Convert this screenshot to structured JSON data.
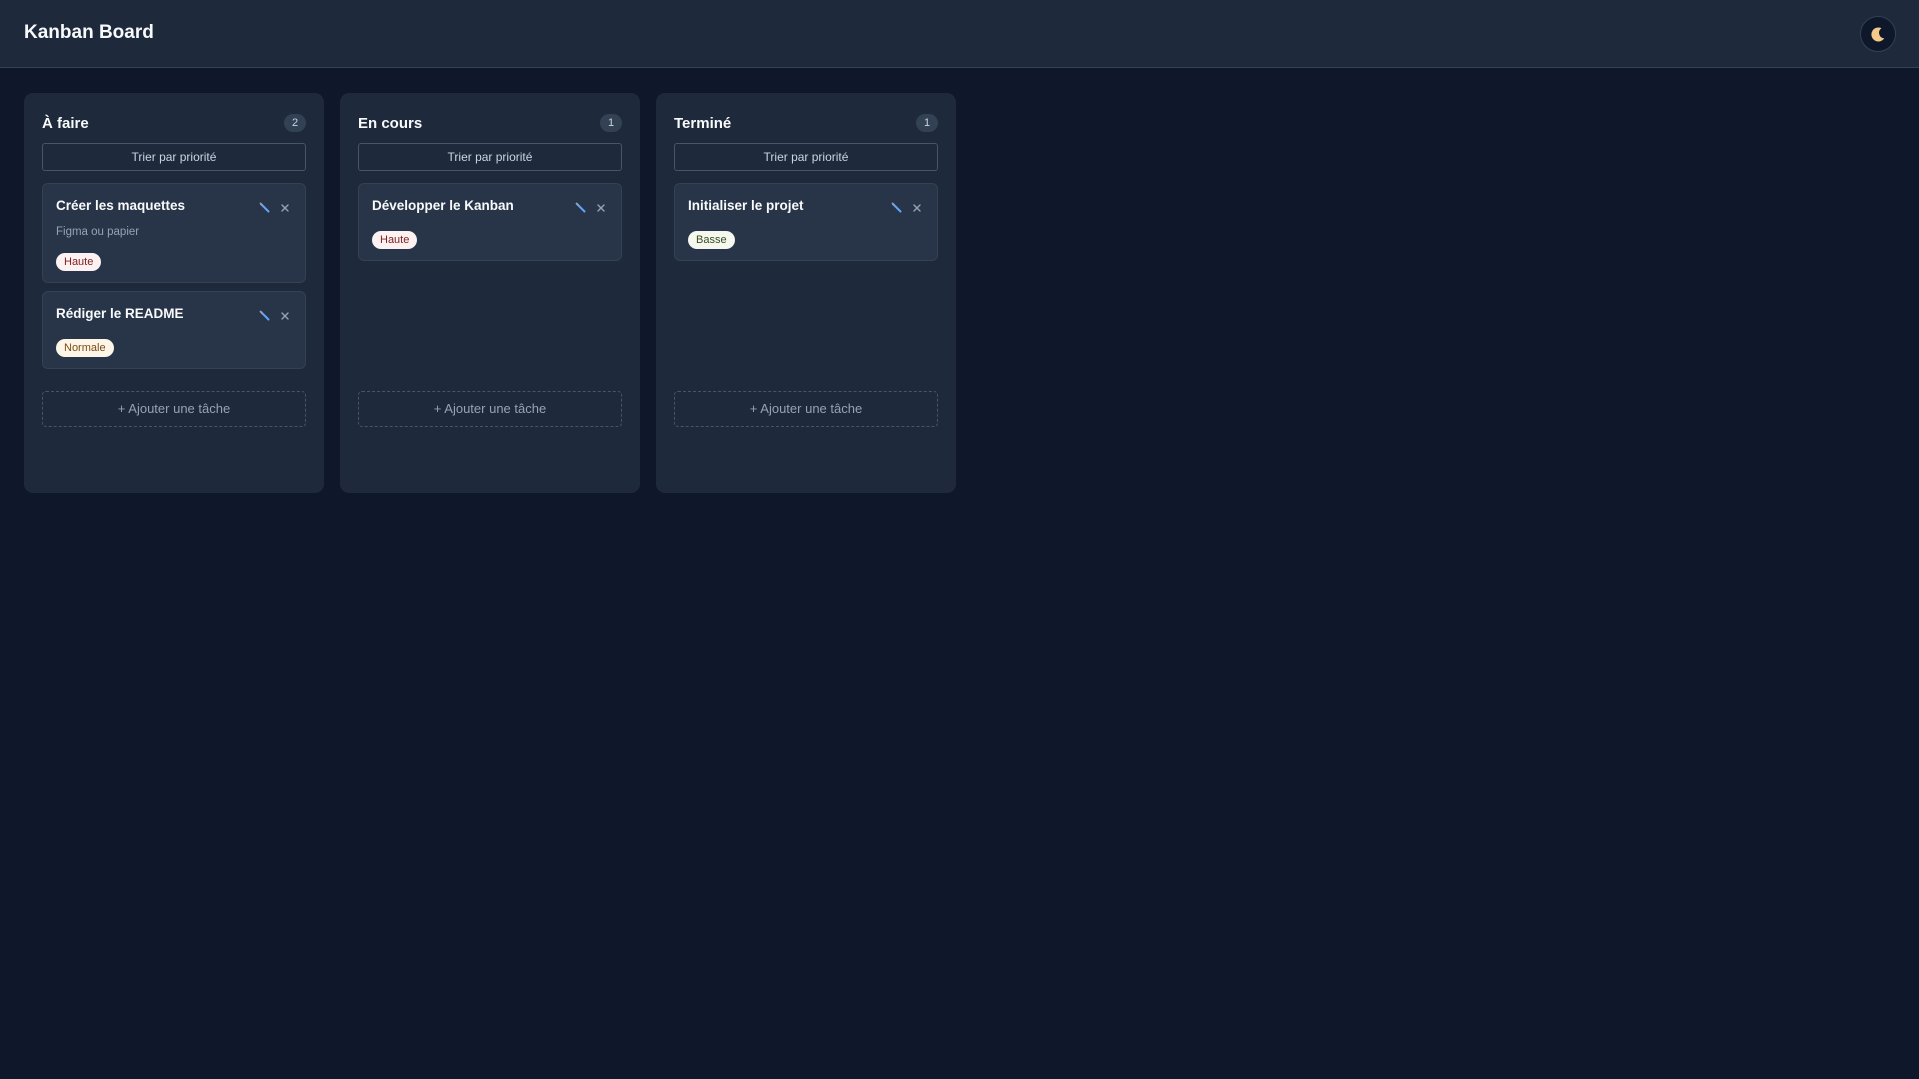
{
  "header": {
    "title": "Kanban Board",
    "theme_toggle_icon": "moon-icon"
  },
  "columns": [
    {
      "title": "À faire",
      "count": "2",
      "sort_label": "Trier par priorité",
      "add_label": "+ Ajouter une tâche",
      "cards": [
        {
          "title": "Créer les maquettes",
          "description": "Figma ou papier",
          "priority": "Haute"
        },
        {
          "title": "Rédiger le README",
          "description": "",
          "priority": "Normale"
        }
      ]
    },
    {
      "title": "En cours",
      "count": "1",
      "sort_label": "Trier par priorité",
      "add_label": "+ Ajouter une tâche",
      "cards": [
        {
          "title": "Développer le Kanban",
          "description": "",
          "priority": "Haute"
        }
      ]
    },
    {
      "title": "Terminé",
      "count": "1",
      "sort_label": "Trier par priorité",
      "add_label": "+ Ajouter une tâche",
      "cards": [
        {
          "title": "Initialiser le projet",
          "description": "",
          "priority": "Basse"
        }
      ]
    }
  ],
  "colors": {
    "background": "#0f172a",
    "panel": "#1e293b",
    "card": "#283548",
    "border": "#334155",
    "moon_accent": "#f4c98a"
  }
}
